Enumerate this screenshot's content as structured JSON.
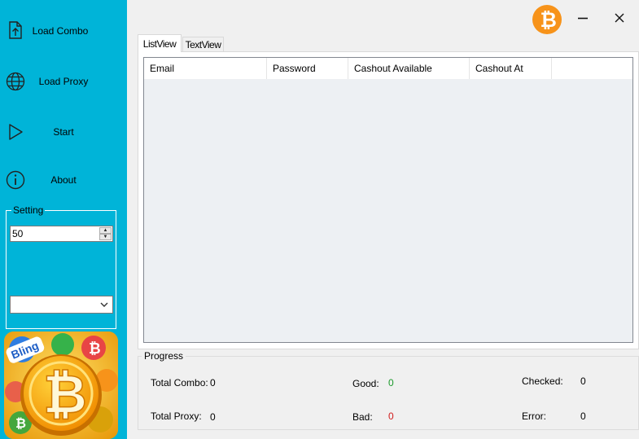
{
  "sidebar": {
    "items": [
      {
        "label": "Load Combo",
        "icon": "file-upload-icon"
      },
      {
        "label": "Load Proxy",
        "icon": "globe-icon"
      },
      {
        "label": "Start",
        "icon": "play-icon"
      },
      {
        "label": "About",
        "icon": "info-icon"
      }
    ],
    "setting": {
      "label": "Setting",
      "threads_value": "50",
      "dropdown_value": ""
    },
    "logo_text": "Bling"
  },
  "tabs": [
    {
      "label": "ListView",
      "active": true
    },
    {
      "label": "TextView",
      "active": false
    }
  ],
  "table": {
    "columns": [
      "Email",
      "Password",
      "Cashout Available",
      "Cashout At"
    ],
    "rows": []
  },
  "progress": {
    "label": "Progress",
    "total_combo": {
      "label": "Total Combo:",
      "value": "0"
    },
    "total_proxy": {
      "label": "Total Proxy:",
      "value": "0"
    },
    "good": {
      "label": "Good:",
      "value": "0"
    },
    "bad": {
      "label": "Bad:",
      "value": "0"
    },
    "checked": {
      "label": "Checked:",
      "value": "0"
    },
    "error": {
      "label": "Error:",
      "value": "0"
    }
  },
  "colors": {
    "sidebar_bg": "#00b4d8",
    "bitcoin_orange": "#f7931a",
    "good_green": "#1b9a2b",
    "bad_red": "#d11c1c"
  }
}
